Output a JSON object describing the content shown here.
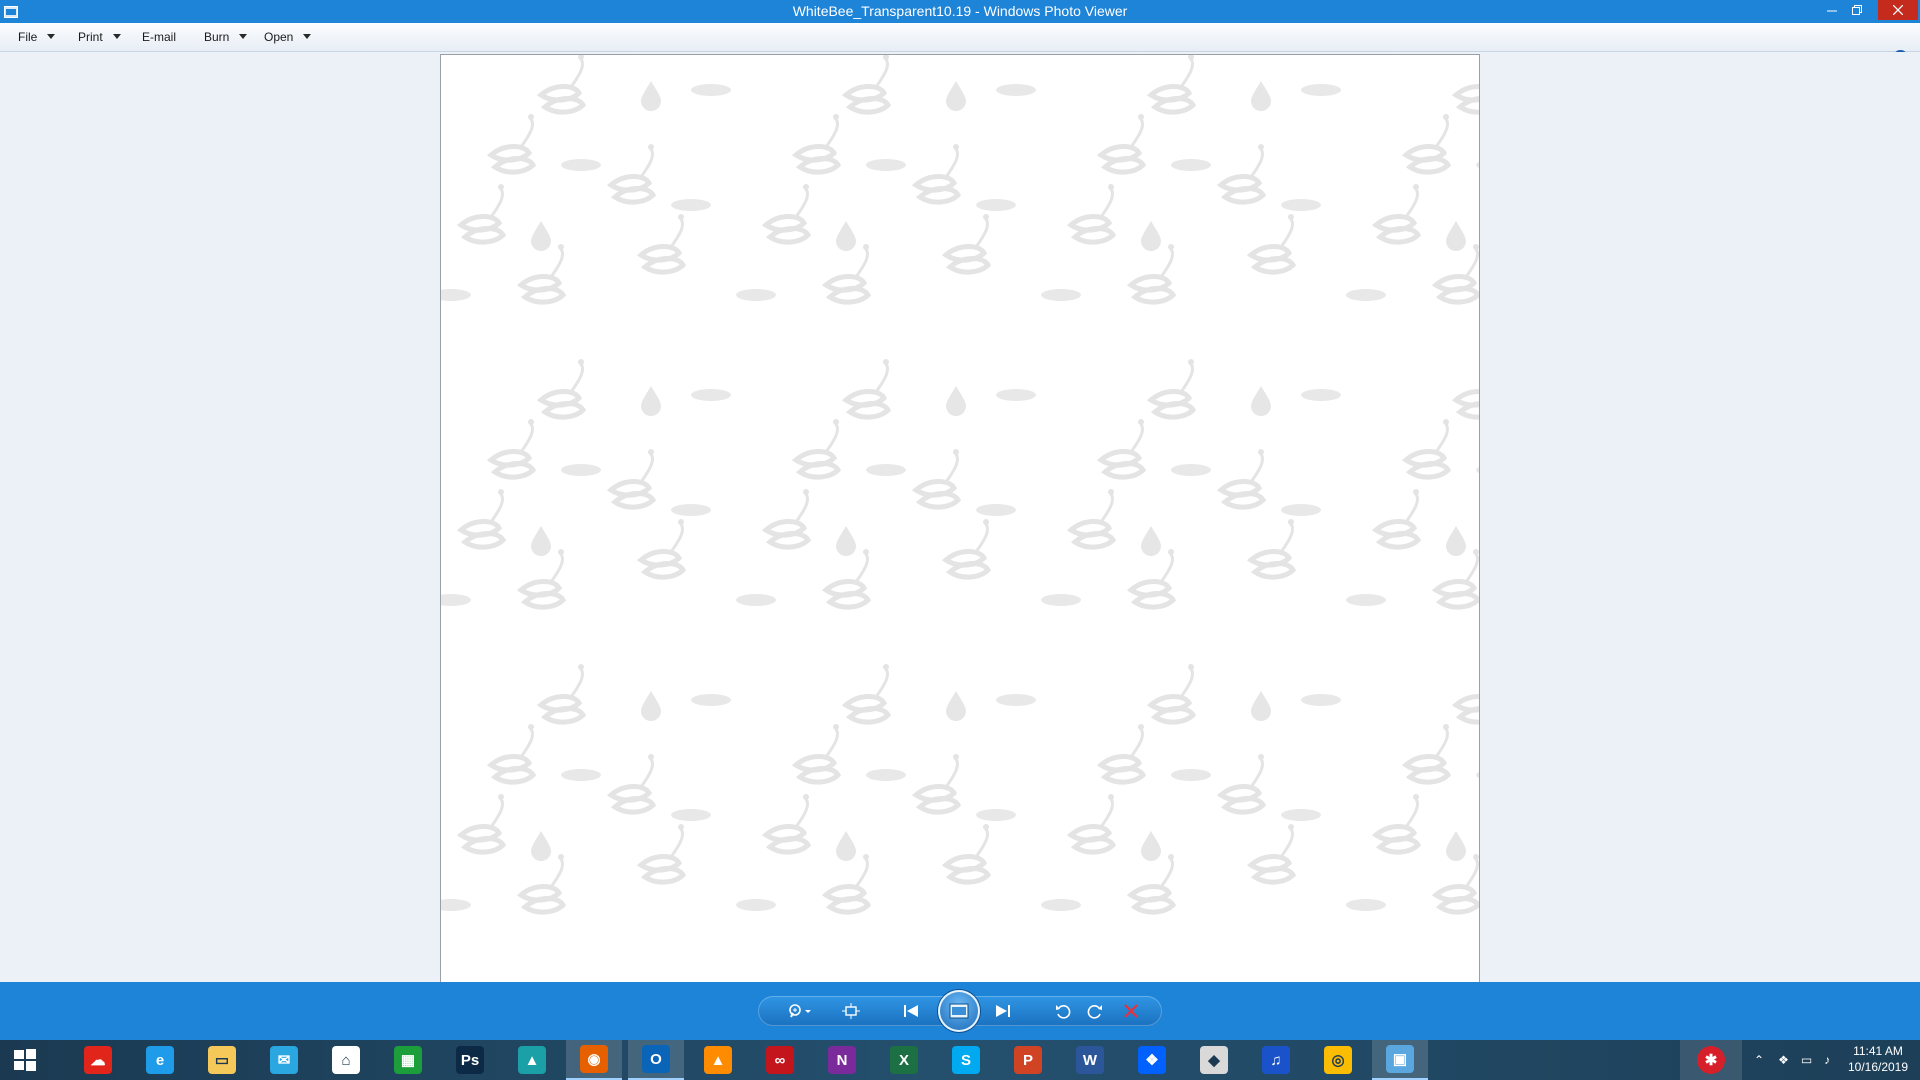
{
  "window": {
    "title": "WhiteBee_Transparent10.19 - Windows Photo Viewer"
  },
  "menu": {
    "items": [
      {
        "label": "File",
        "has_dropdown": true
      },
      {
        "label": "Print",
        "has_dropdown": true
      },
      {
        "label": "E-mail",
        "has_dropdown": false
      },
      {
        "label": "Burn",
        "has_dropdown": true
      },
      {
        "label": "Open",
        "has_dropdown": true
      }
    ],
    "help_label": "?"
  },
  "controls": {
    "icons": [
      "zoom-icon",
      "actual-size-icon",
      "previous-icon",
      "slideshow-icon",
      "next-icon",
      "rotate-left-icon",
      "rotate-right-icon",
      "delete-icon"
    ]
  },
  "taskbar": {
    "apps": [
      {
        "name": "creative-cloud-icon",
        "color": "#e1251b",
        "glyph": "☁"
      },
      {
        "name": "internet-explorer-icon",
        "color": "#1e9be9",
        "glyph": "e"
      },
      {
        "name": "file-explorer-icon",
        "color": "#f5c85a",
        "glyph": "▭"
      },
      {
        "name": "mail-icon",
        "color": "#2aa6e0",
        "glyph": "✉"
      },
      {
        "name": "home-icon",
        "color": "#ffffff",
        "glyph": "⌂"
      },
      {
        "name": "store-icon",
        "color": "#1c9f3a",
        "glyph": "▦"
      },
      {
        "name": "photoshop-icon",
        "color": "#0c2a45",
        "glyph": "Ps"
      },
      {
        "name": "photos-icon",
        "color": "#1aa0a6",
        "glyph": "▲"
      },
      {
        "name": "firefox-icon",
        "color": "#e66000",
        "glyph": "◉"
      },
      {
        "name": "outlook-icon",
        "color": "#0a64b8",
        "glyph": "O"
      },
      {
        "name": "vlc-icon",
        "color": "#ff8c00",
        "glyph": "▲"
      },
      {
        "name": "creative-cloud-desktop-icon",
        "color": "#c4151c",
        "glyph": "∞"
      },
      {
        "name": "onenote-icon",
        "color": "#7a2a9a",
        "glyph": "N"
      },
      {
        "name": "excel-icon",
        "color": "#1d7044",
        "glyph": "X"
      },
      {
        "name": "skype-icon",
        "color": "#00a9f0",
        "glyph": "S"
      },
      {
        "name": "powerpoint-icon",
        "color": "#d04423",
        "glyph": "P"
      },
      {
        "name": "word-icon",
        "color": "#2b579a",
        "glyph": "W"
      },
      {
        "name": "dropbox-icon",
        "color": "#0061ff",
        "glyph": "❖"
      },
      {
        "name": "inkscape-icon",
        "color": "#d9d9d9",
        "glyph": "◆"
      },
      {
        "name": "audio-app-icon",
        "color": "#1a52c9",
        "glyph": "♫"
      },
      {
        "name": "chrome-icon",
        "color": "#fbbc04",
        "glyph": "◎"
      },
      {
        "name": "photo-viewer-icon",
        "color": "#5aa6df",
        "glyph": "▣"
      }
    ],
    "active_indices": [
      8,
      9,
      21
    ],
    "clock": {
      "time": "11:41 AM",
      "date": "10/16/2019"
    }
  }
}
